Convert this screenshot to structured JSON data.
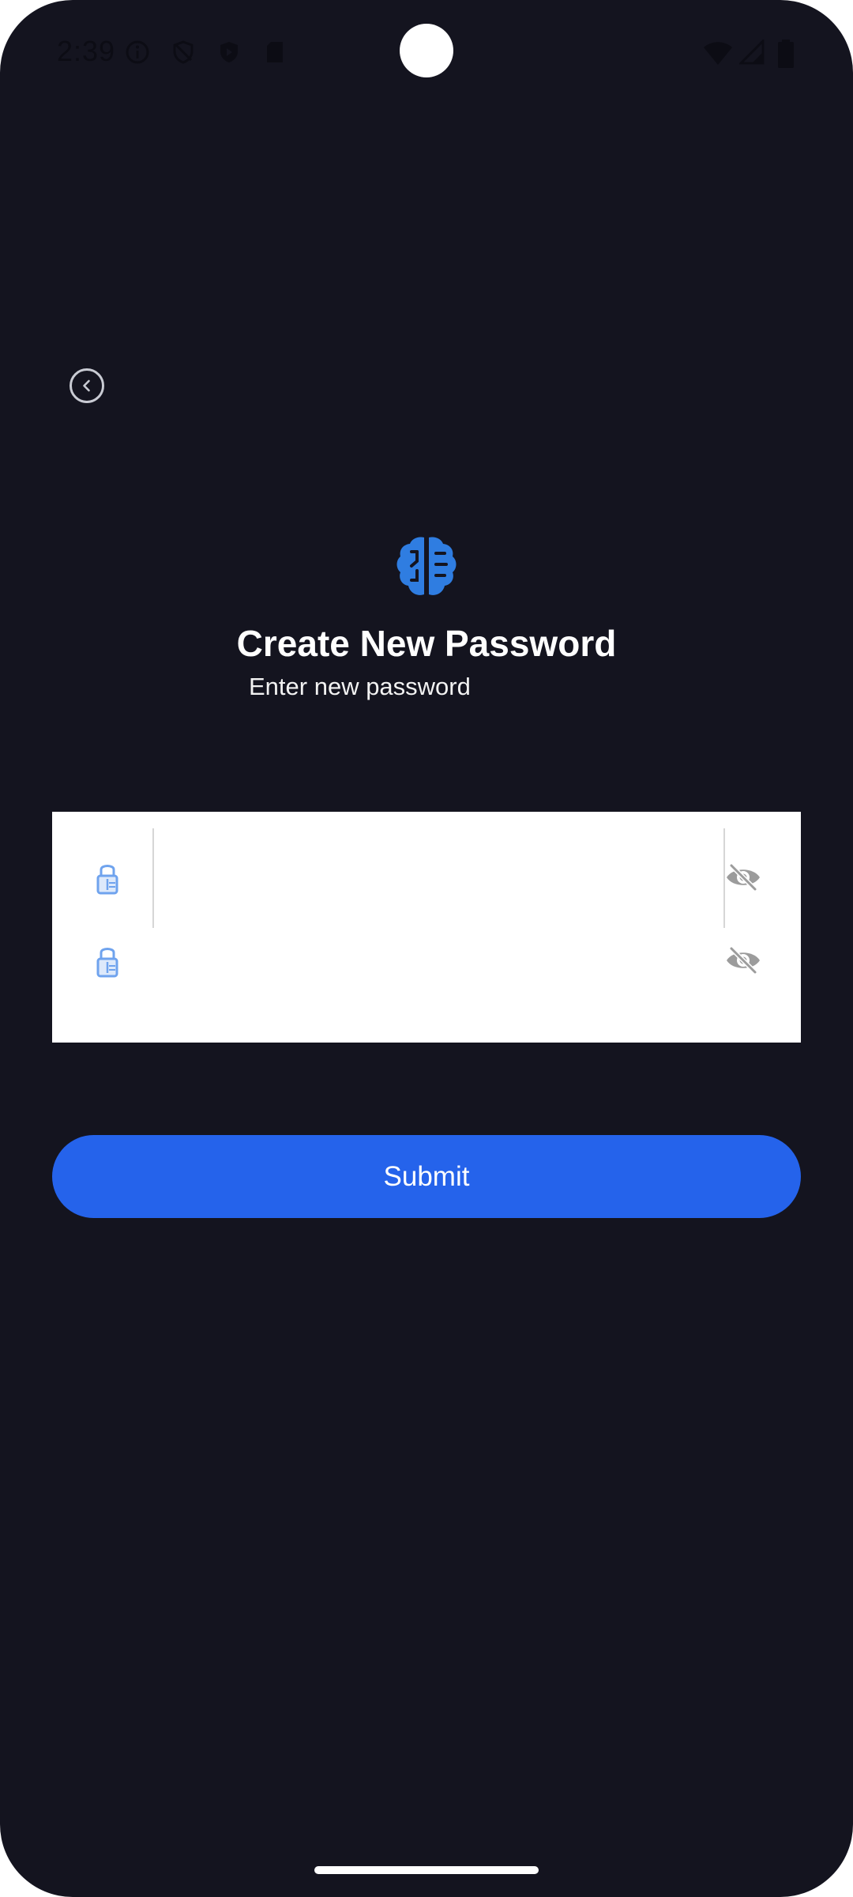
{
  "status_bar": {
    "time": "2:39",
    "icons": [
      "info-icon",
      "shield-off-icon",
      "shield-icon",
      "sd-card-icon",
      "wifi-icon",
      "signal-icon",
      "battery-icon"
    ]
  },
  "header": {
    "back_icon": "chevron-left-icon",
    "logo_icon": "brain-icon",
    "title": "Create New Password",
    "subtitle": "Enter new password"
  },
  "form": {
    "fields": [
      {
        "name": "new-password",
        "value": "",
        "placeholder": "",
        "lead_icon": "lock-icon",
        "trail_icon": "eye-off-icon"
      },
      {
        "name": "confirm-password",
        "value": "",
        "placeholder": "",
        "lead_icon": "lock-icon",
        "trail_icon": "eye-off-icon"
      }
    ]
  },
  "actions": {
    "submit_label": "Submit"
  },
  "colors": {
    "background": "#14141f",
    "accent": "#2563eb",
    "logo": "#2f7de1",
    "card": "#ffffff"
  }
}
